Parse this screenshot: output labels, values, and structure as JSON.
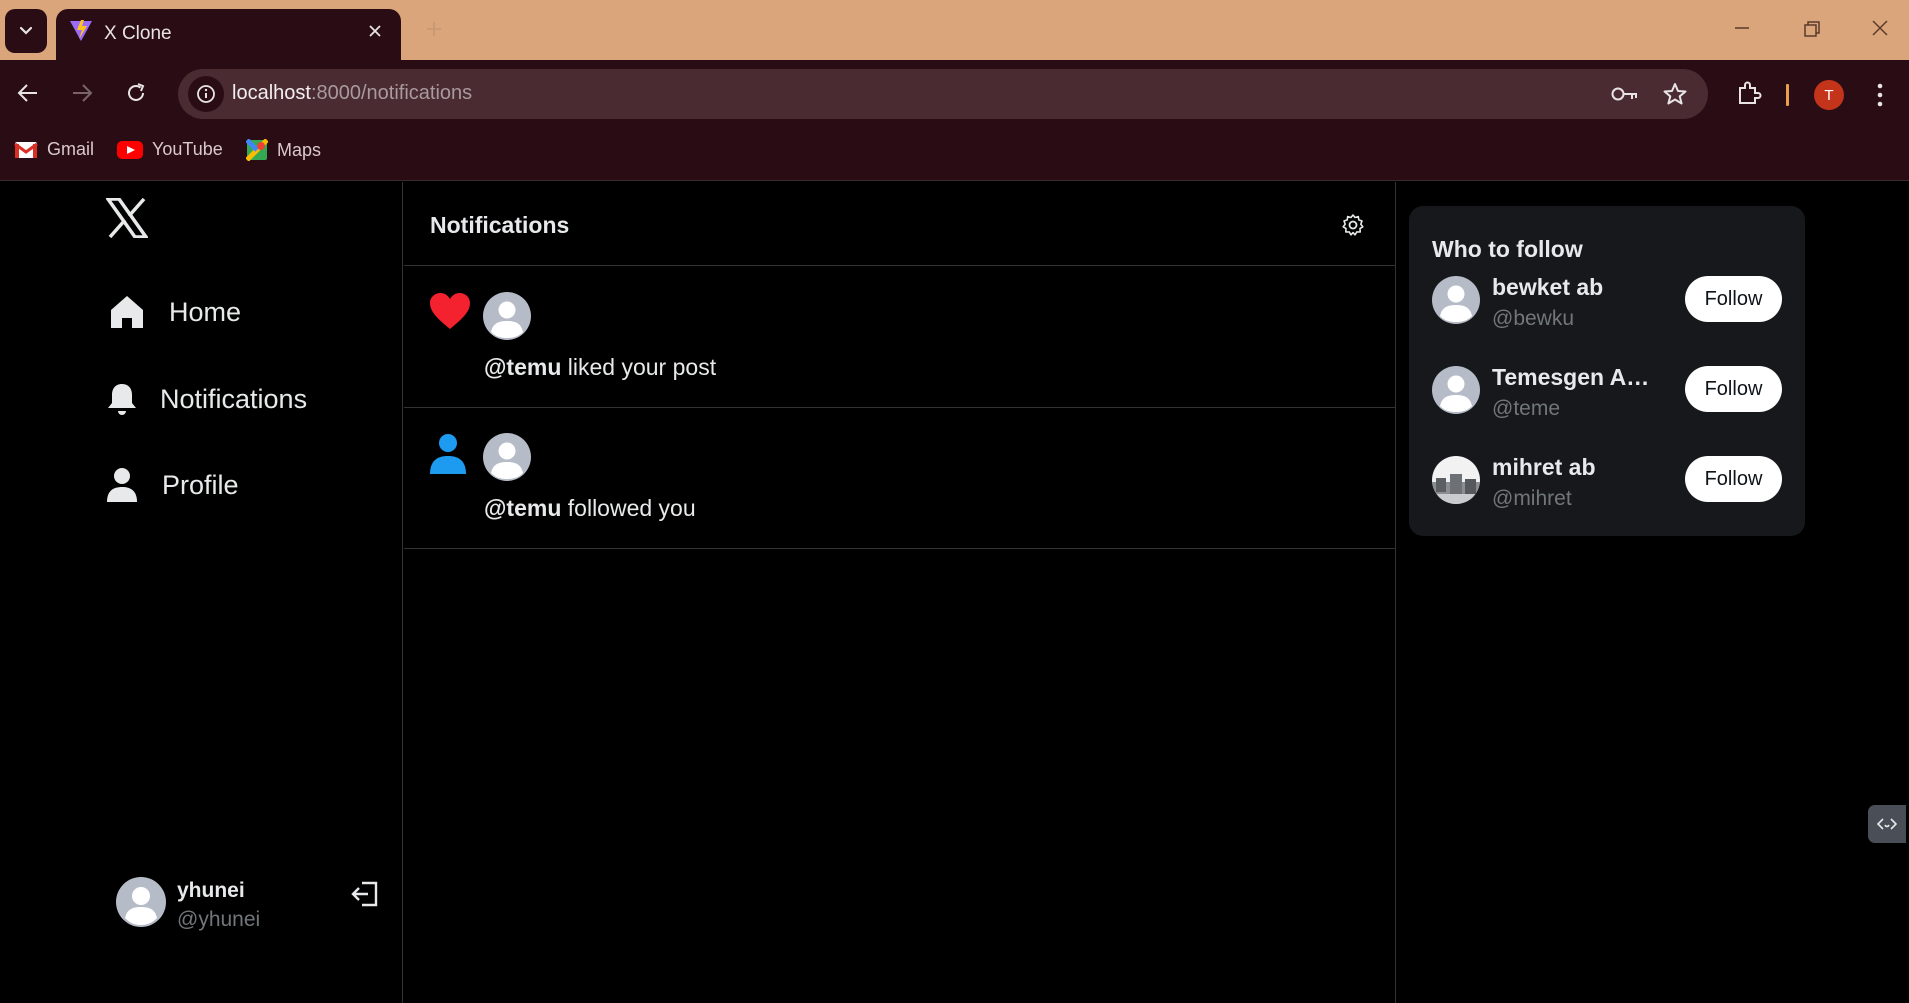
{
  "browser": {
    "tab_title": "X Clone",
    "url_host": "localhost",
    "url_path": ":8000/notifications",
    "profile_initial": "T",
    "bookmarks": [
      {
        "label": "Gmail",
        "icon": "gmail-icon"
      },
      {
        "label": "YouTube",
        "icon": "youtube-icon"
      },
      {
        "label": "Maps",
        "icon": "maps-icon"
      }
    ]
  },
  "sidebar": {
    "logo": "x-logo-icon",
    "items": [
      {
        "label": "Home",
        "icon": "home-icon"
      },
      {
        "label": "Notifications",
        "icon": "bell-icon"
      },
      {
        "label": "Profile",
        "icon": "user-icon"
      }
    ],
    "current_user": {
      "name": "yhunei",
      "handle": "@yhunei"
    }
  },
  "notifications": {
    "title": "Notifications",
    "items": [
      {
        "type": "like",
        "icon": "heart-icon",
        "user": "@temu",
        "text": " liked your post"
      },
      {
        "type": "follow",
        "icon": "user-icon",
        "user": "@temu",
        "text": " followed you"
      }
    ]
  },
  "who_to_follow": {
    "title": "Who to follow",
    "users": [
      {
        "name": "bewket ab",
        "handle": "@bewku",
        "button": "Follow"
      },
      {
        "name": "Temesgen Ab...",
        "handle": "@teme",
        "button": "Follow"
      },
      {
        "name": "mihret ab",
        "handle": "@mihret",
        "button": "Follow"
      }
    ]
  },
  "colors": {
    "tabbar_bg": "#dba57c",
    "chrome_bg": "#2a0c14",
    "page_bg": "#000000",
    "like_red": "#f4212e",
    "follow_blue": "#1d9bf0",
    "card_bg": "#16181c",
    "border": "#2f3336",
    "muted_text": "#71767b"
  }
}
